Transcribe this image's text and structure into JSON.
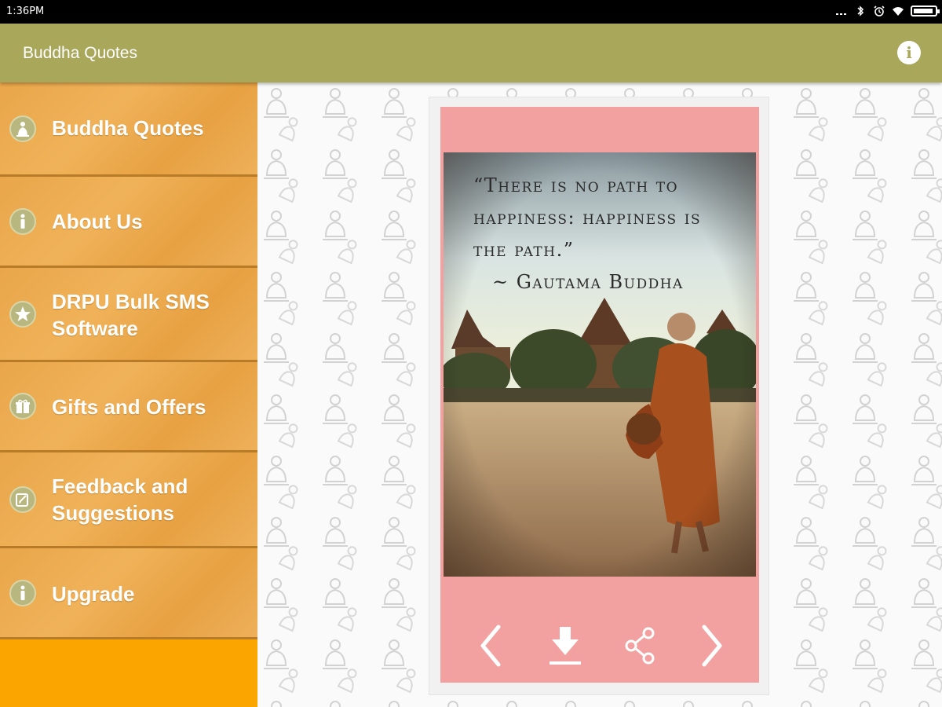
{
  "status_bar": {
    "time": "1:36PM",
    "icons": [
      "more-icon",
      "bluetooth-icon",
      "alarm-icon",
      "wifi-icon",
      "battery-icon"
    ]
  },
  "app_bar": {
    "title": "Buddha Quotes",
    "background": "#a9a75a",
    "info_icon": "i"
  },
  "sidebar": {
    "items": [
      {
        "label": "Buddha Quotes",
        "icon": "buddha-icon"
      },
      {
        "label": "About Us",
        "icon": "info-icon"
      },
      {
        "label": "DRPU Bulk SMS Software",
        "icon": "star-icon"
      },
      {
        "label": "Gifts and Offers",
        "icon": "gift-icon"
      },
      {
        "label": "Feedback and Suggestions",
        "icon": "feedback-icon"
      },
      {
        "label": "Upgrade",
        "icon": "info-icon"
      }
    ],
    "accent": "#fba600"
  },
  "quote_card": {
    "quote_text": "“There is no path to happiness: happiness is the path.”",
    "author": "~ Gautama Buddha",
    "card_color": "#f2a0a0",
    "controls": [
      "previous-icon",
      "download-icon",
      "share-icon",
      "next-icon"
    ]
  }
}
